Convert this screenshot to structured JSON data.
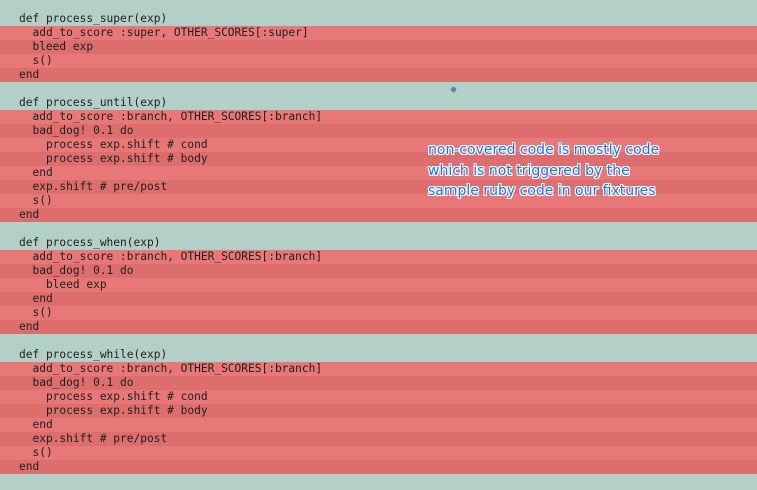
{
  "code_lines": [
    {
      "text": "def process_super(exp)",
      "status": "covered"
    },
    {
      "text": "  add_to_score :super, OTHER_SCORES[:super]",
      "status": "uncovered"
    },
    {
      "text": "  bleed exp",
      "status": "uncovered"
    },
    {
      "text": "  s()",
      "status": "uncovered"
    },
    {
      "text": "end",
      "status": "uncovered"
    },
    {
      "text": "",
      "status": "blank"
    },
    {
      "text": "def process_until(exp)",
      "status": "covered"
    },
    {
      "text": "  add_to_score :branch, OTHER_SCORES[:branch]",
      "status": "uncovered"
    },
    {
      "text": "  bad_dog! 0.1 do",
      "status": "uncovered"
    },
    {
      "text": "    process exp.shift # cond",
      "status": "uncovered"
    },
    {
      "text": "    process exp.shift # body",
      "status": "uncovered"
    },
    {
      "text": "  end",
      "status": "uncovered"
    },
    {
      "text": "  exp.shift # pre/post",
      "status": "uncovered"
    },
    {
      "text": "  s()",
      "status": "uncovered"
    },
    {
      "text": "end",
      "status": "uncovered"
    },
    {
      "text": "",
      "status": "blank"
    },
    {
      "text": "def process_when(exp)",
      "status": "covered"
    },
    {
      "text": "  add_to_score :branch, OTHER_SCORES[:branch]",
      "status": "uncovered"
    },
    {
      "text": "  bad_dog! 0.1 do",
      "status": "uncovered"
    },
    {
      "text": "    bleed exp",
      "status": "uncovered"
    },
    {
      "text": "  end",
      "status": "uncovered"
    },
    {
      "text": "  s()",
      "status": "uncovered"
    },
    {
      "text": "end",
      "status": "uncovered"
    },
    {
      "text": "",
      "status": "blank"
    },
    {
      "text": "def process_while(exp)",
      "status": "covered"
    },
    {
      "text": "  add_to_score :branch, OTHER_SCORES[:branch]",
      "status": "uncovered"
    },
    {
      "text": "  bad_dog! 0.1 do",
      "status": "uncovered"
    },
    {
      "text": "    process exp.shift # cond",
      "status": "uncovered"
    },
    {
      "text": "    process exp.shift # body",
      "status": "uncovered"
    },
    {
      "text": "  end",
      "status": "uncovered"
    },
    {
      "text": "  exp.shift # pre/post",
      "status": "uncovered"
    },
    {
      "text": "  s()",
      "status": "uncovered"
    },
    {
      "text": "end",
      "status": "uncovered"
    }
  ],
  "annotation": {
    "lines": [
      "non-covered code is mostly code",
      "which is not triggered by the",
      "sample ruby code in our fixtures"
    ]
  },
  "colors": {
    "covered": "#b3d0c8",
    "uncovered_light": "#e87878",
    "uncovered_dark": "#de6e6e",
    "annotation_text": "#1f6ff0"
  }
}
